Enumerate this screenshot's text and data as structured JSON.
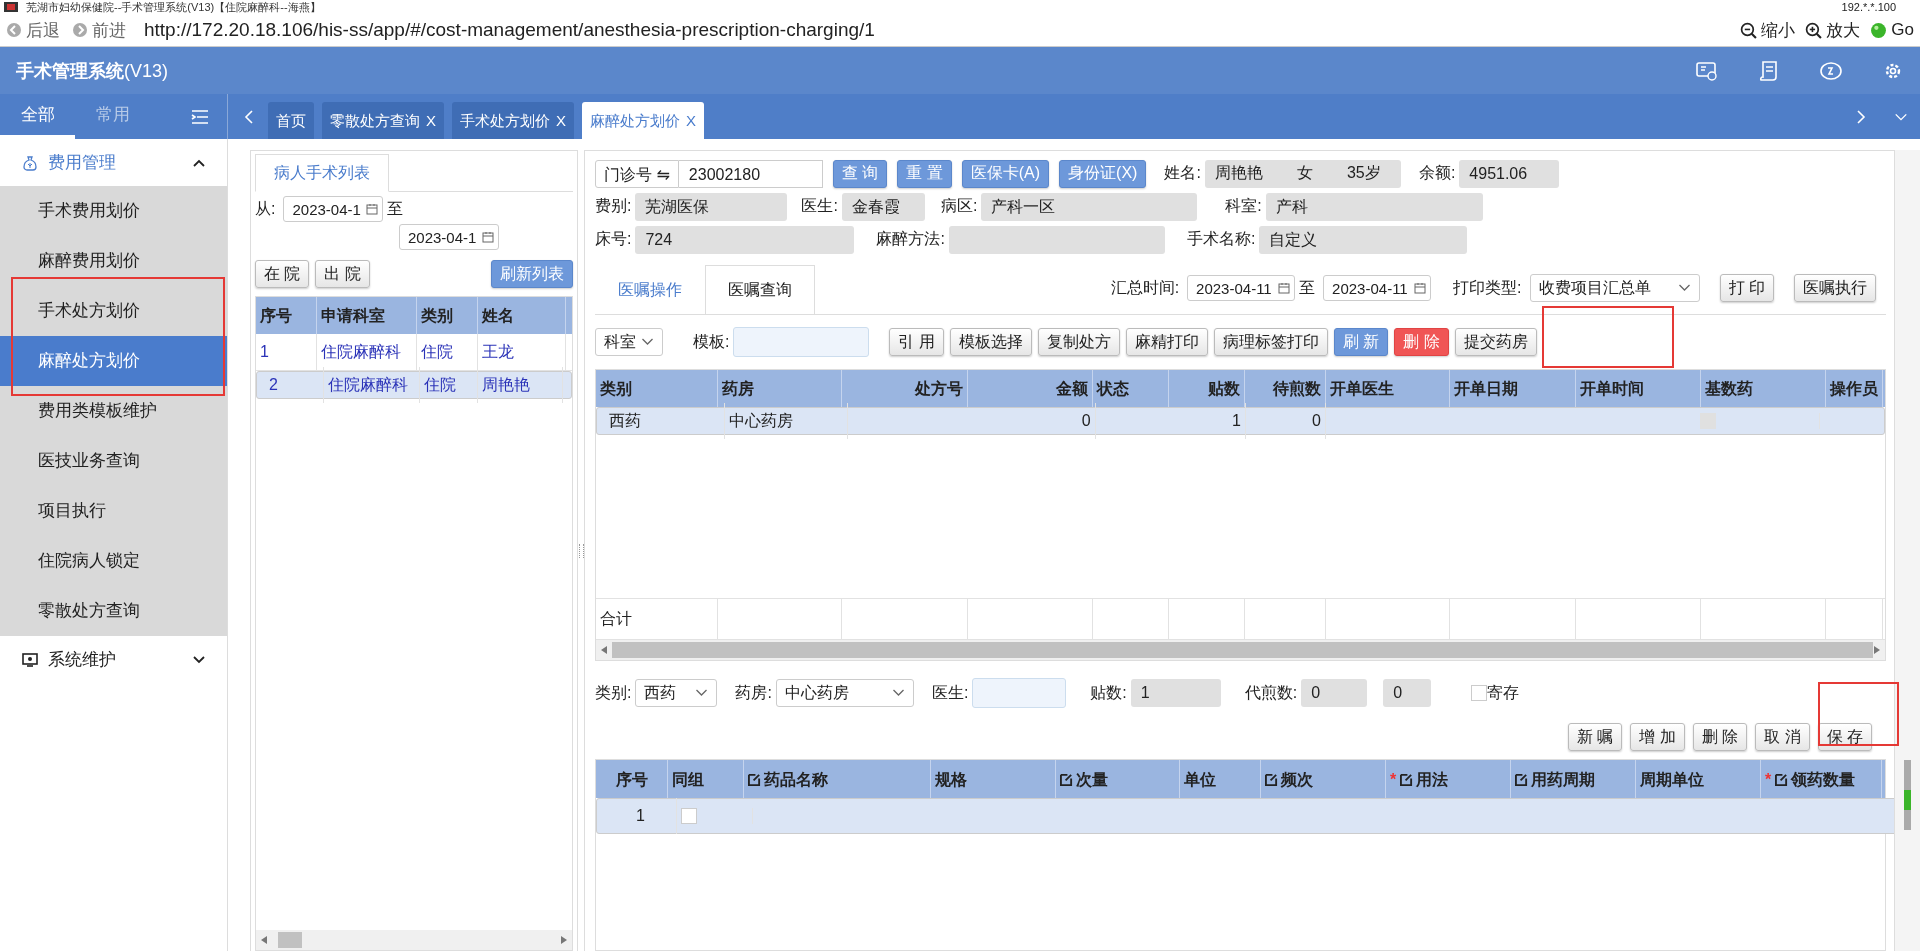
{
  "window": {
    "title": "芜湖市妇幼保健院--手术管理系统(V13)【住院麻醉科--海燕】",
    "host": "192.*.*.100"
  },
  "browser": {
    "back": "后退",
    "forward": "前进",
    "url": "http://172.20.18.106/his-ss/app/#/cost-management/anesthesia-prescription-charging/1",
    "zoom_out": "缩小",
    "zoom_in": "放大",
    "go": "Go"
  },
  "app": {
    "title": "手术管理系统",
    "version": "(V13)"
  },
  "sidebar": {
    "tabs": [
      {
        "label": "全部",
        "selected": true
      },
      {
        "label": "常用",
        "selected": false
      }
    ],
    "groups": [
      {
        "label": "费用管理",
        "expanded": true,
        "items": [
          {
            "label": "手术费用划价",
            "selected": false
          },
          {
            "label": "麻醉费用划价",
            "selected": false
          },
          {
            "label": "手术处方划价",
            "selected": false
          },
          {
            "label": "麻醉处方划价",
            "selected": true
          },
          {
            "label": "费用类模板维护",
            "selected": false
          },
          {
            "label": "医技业务查询",
            "selected": false
          },
          {
            "label": "项目执行",
            "selected": false
          },
          {
            "label": "住院病人锁定",
            "selected": false
          },
          {
            "label": "零散处方查询",
            "selected": false
          }
        ]
      },
      {
        "label": "系统维护",
        "expanded": false
      }
    ]
  },
  "tabs": [
    {
      "label": "首页",
      "selected": false
    },
    {
      "label": "零散处方查询",
      "close": "X",
      "selected": false
    },
    {
      "label": "手术处方划价",
      "close": "X",
      "selected": false
    },
    {
      "label": "麻醉处方划价",
      "close": "X",
      "selected": true
    }
  ],
  "patient_list": {
    "tab": "病人手术列表",
    "from_label": "从:",
    "from": "2023-04-1",
    "to_label": "至",
    "to": "2023-04-1",
    "buttons": [
      "在 院",
      "出 院"
    ],
    "refresh": "刷新列表",
    "columns": [
      "序号",
      "申请科室",
      "类别",
      "姓名"
    ],
    "rows": [
      {
        "cells": [
          "1",
          "住院麻醉科",
          "住院",
          "王龙"
        ],
        "selected": false
      },
      {
        "cells": [
          "2",
          "住院麻醉科",
          "住院",
          "周艳艳"
        ],
        "selected": true
      }
    ]
  },
  "patient": {
    "id_selector": "门诊号 ⇋",
    "id": "23002180",
    "buttons": [
      "查 询",
      "重 置",
      "医保卡(A)",
      "身份证(X)"
    ],
    "name_label": "姓名:",
    "name": "周艳艳",
    "sex": "女",
    "age": "35岁",
    "balance_label": "余额:",
    "balance": "4951.06",
    "fee_type": {
      "label": "费别:",
      "value": "芜湖医保"
    },
    "doctor": {
      "label": "医生:",
      "value": "金春霞"
    },
    "ward": {
      "label": "病区:",
      "value": "产科一区"
    },
    "department": {
      "label": "科室:",
      "value": "产科"
    },
    "bed": {
      "label": "床号:",
      "value": "724"
    },
    "anesthesia_method": {
      "label": "麻醉方法:"
    },
    "surgery_name": {
      "label": "手术名称:",
      "value": "自定义"
    }
  },
  "order_tabs": [
    {
      "label": "医嘱操作",
      "selected": true
    },
    {
      "label": "医嘱查询",
      "selected": false
    }
  ],
  "summary": {
    "label": "汇总时间:",
    "from": "2023-04-11",
    "to_label": "至",
    "to": "2023-04-11",
    "print_type_label": "打印类型:",
    "print_type": "收费项目汇总单",
    "buttons": [
      "打 印",
      "医嘱执行"
    ]
  },
  "toolbar": {
    "dept": "科室",
    "template_label": "模板:",
    "buttons": [
      {
        "label": "引 用",
        "kind": "default"
      },
      {
        "label": "模板选择",
        "kind": "default"
      },
      {
        "label": "复制处方",
        "kind": "default"
      },
      {
        "label": "麻精打印",
        "kind": "default"
      },
      {
        "label": "病理标签打印",
        "kind": "default"
      },
      {
        "label": "刷 新",
        "kind": "primary"
      },
      {
        "label": "删 除",
        "kind": "danger"
      },
      {
        "label": "提交药房",
        "kind": "default"
      }
    ]
  },
  "orders": {
    "columns": [
      "类别",
      "药房",
      "处方号",
      "金额",
      "状态",
      "贴数",
      "待煎数",
      "开单医生",
      "开单日期",
      "开单时间",
      "基数药",
      "操作员"
    ],
    "rows": [
      {
        "category": "西药",
        "pharmacy": "中心药房",
        "amount": "0",
        "doses": "1",
        "pending": "0",
        "base_drug": false,
        "selected": true
      }
    ],
    "footer": "合计"
  },
  "detail_form": {
    "category_label": "类别:",
    "category": "西药",
    "pharmacy_label": "药房:",
    "pharmacy": "中心药房",
    "doctor_label": "医生:",
    "doses_label": "贴数:",
    "doses": "1",
    "decoct_label": "代煎数:",
    "decoct": "0",
    "decoct_2": "0",
    "deposit_label": "寄存",
    "deposit": false,
    "buttons": [
      "新 嘱",
      "增 加",
      "删 除",
      "取 消",
      "保 存"
    ]
  },
  "details": {
    "columns": [
      {
        "label": "序号",
        "editable": false,
        "required": false
      },
      {
        "label": "同组",
        "editable": false,
        "required": false
      },
      {
        "label": "药品名称",
        "editable": true,
        "required": false
      },
      {
        "label": "规格",
        "editable": false,
        "required": false
      },
      {
        "label": "次量",
        "editable": true,
        "required": false
      },
      {
        "label": "单位",
        "editable": false,
        "required": false
      },
      {
        "label": "频次",
        "editable": true,
        "required": false
      },
      {
        "label": "用法",
        "editable": true,
        "required": true
      },
      {
        "label": "用药周期",
        "editable": true,
        "required": false
      },
      {
        "label": "周期单位",
        "editable": false,
        "required": false
      },
      {
        "label": "领药数量",
        "editable": true,
        "required": true
      }
    ],
    "required_mark": "*",
    "rows": [
      {
        "index": "1",
        "group": false,
        "selected": true
      }
    ]
  }
}
